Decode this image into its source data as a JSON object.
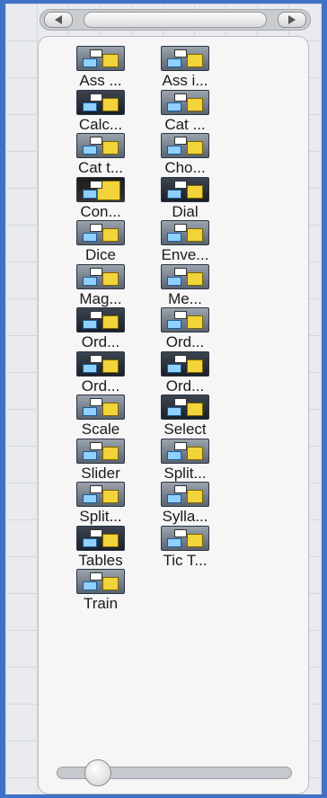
{
  "colors": {
    "window_border": "#3f72c6",
    "panel_bg": "#f6f6f6",
    "icon_accent": "#f2d33a"
  },
  "scrollbar": {
    "left_icon": "arrow-left-icon",
    "right_icon": "arrow-right-icon"
  },
  "tools": [
    {
      "label": "Ass ...",
      "icon": "assign-icon"
    },
    {
      "label": "Ass i...",
      "icon": "assign-image-icon"
    },
    {
      "label": "Calc...",
      "icon": "calculator-icon"
    },
    {
      "label": "Cat ...",
      "icon": "categorize-icon"
    },
    {
      "label": "Cat t...",
      "icon": "categorize-text-icon"
    },
    {
      "label": "Cho...",
      "icon": "choice-list-icon"
    },
    {
      "label": "Con...",
      "icon": "container-icon"
    },
    {
      "label": "Dial",
      "icon": "dial-icon"
    },
    {
      "label": "Dice",
      "icon": "dice-icon"
    },
    {
      "label": "Enve...",
      "icon": "envelope-icon"
    },
    {
      "label": "Mag...",
      "icon": "magnet-icon"
    },
    {
      "label": "Me...",
      "icon": "memory-icon"
    },
    {
      "label": "Ord...",
      "icon": "order-letters-icon"
    },
    {
      "label": "Ord...",
      "icon": "order-images-icon"
    },
    {
      "label": "Ord...",
      "icon": "order-lines-icon"
    },
    {
      "label": "Ord...",
      "icon": "order-dashes-icon"
    },
    {
      "label": "Scale",
      "icon": "scale-icon"
    },
    {
      "label": "Select",
      "icon": "select-icon"
    },
    {
      "label": "Slider",
      "icon": "slider-icon"
    },
    {
      "label": "Split...",
      "icon": "split-icon"
    },
    {
      "label": "Split...",
      "icon": "split-text-icon"
    },
    {
      "label": "Sylla...",
      "icon": "syllable-icon"
    },
    {
      "label": "Tables",
      "icon": "tables-icon"
    },
    {
      "label": "Tic T...",
      "icon": "tic-tac-toe-icon"
    },
    {
      "label": "Train",
      "icon": "train-icon"
    }
  ]
}
